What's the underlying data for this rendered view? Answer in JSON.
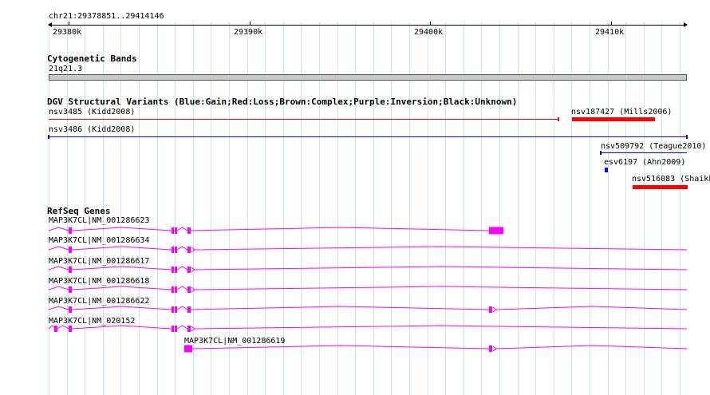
{
  "browser": {
    "location": "chr21:29378851..29414146",
    "ruler_ticks": [
      {
        "label": "29380k",
        "value": 29380000
      },
      {
        "label": "29390k",
        "value": 29390000
      },
      {
        "label": "29400k",
        "value": 29400000
      },
      {
        "label": "29410k",
        "value": 29410000
      }
    ],
    "view_start": 29378851,
    "view_end": 29414146
  },
  "tracks": {
    "cytoband": {
      "title": "Cytogenetic Bands",
      "band_label": "21q21.3",
      "band_color": "#c8c8c8"
    },
    "dgv": {
      "title": "DGV Structural Variants (Blue:Gain;Red:Loss;Brown:Complex;Purple:Inversion;Black:Unknown)",
      "colors": {
        "gain": "#0000ff",
        "loss": "#ff0000"
      },
      "features": [
        {
          "label": "nsv3485 (Kidd2008)",
          "type": "loss",
          "style": "line"
        },
        {
          "label": "nsv187427 (Mills2006)",
          "type": "loss",
          "style": "box"
        },
        {
          "label": "nsv3486 (Kidd2008)",
          "type": "gain",
          "style": "line"
        },
        {
          "label": "nsv509792 (Teague2010)",
          "type": "gain",
          "style": "line"
        },
        {
          "label": "esv6197 (Ahn2009)",
          "type": "gain",
          "style": "box"
        },
        {
          "label": "nsv516083 (Shaikh",
          "type": "loss",
          "style": "box"
        }
      ]
    },
    "refseq": {
      "title": "RefSeq Genes",
      "color": "#ff00ff",
      "transcripts": [
        {
          "label": "MAP3K7CL|NM_001286623"
        },
        {
          "label": "MAP3K7CL|NM_001286634"
        },
        {
          "label": "MAP3K7CL|NM_001286617"
        },
        {
          "label": "MAP3K7CL|NM_001286618"
        },
        {
          "label": "MAP3K7CL|NM_001286622"
        },
        {
          "label": "MAP3K7CL|NM_020152"
        },
        {
          "label": "MAP3K7CL|NM_001286619"
        }
      ]
    }
  }
}
